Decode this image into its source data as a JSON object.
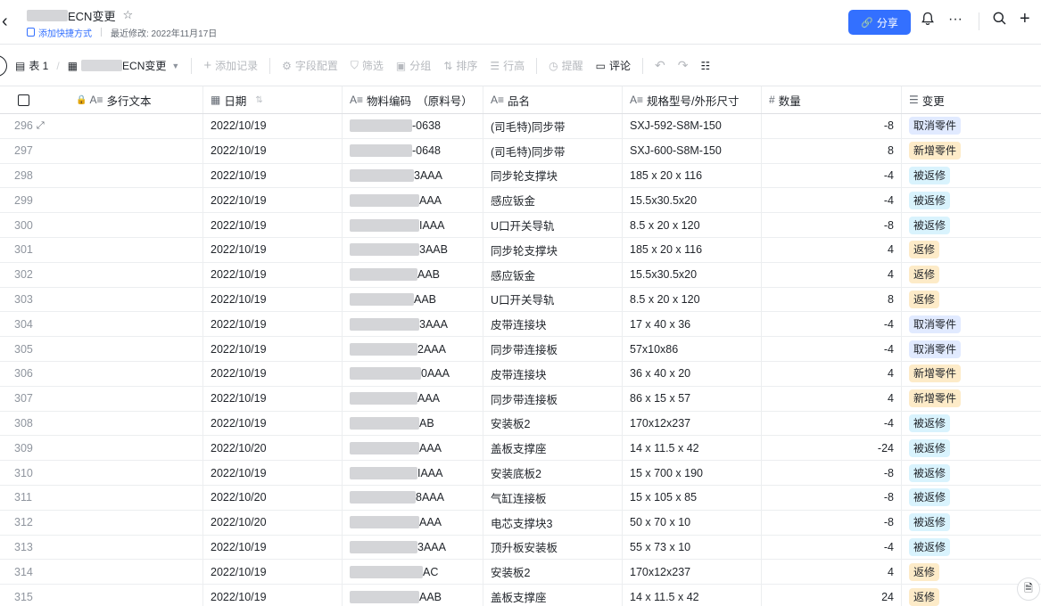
{
  "header": {
    "title_suffix": "ECN变更",
    "shortcut_label": "添加快捷方式",
    "modified_label": "最近修改: 2022年11月17日",
    "share_label": "分享"
  },
  "toolbar": {
    "table_tab": "表 1",
    "view_name_suffix": "ECN变更",
    "add_record": "添加记录",
    "field_config": "字段配置",
    "filter": "筛选",
    "group": "分组",
    "sort": "排序",
    "row_height": "行高",
    "reminder": "提醒",
    "comment": "评论"
  },
  "columns": [
    {
      "label": "多行文本",
      "icon": "text-icon"
    },
    {
      "label": "日期",
      "icon": "calendar-icon"
    },
    {
      "label": "物料编码　（原料号）",
      "icon": "text-icon"
    },
    {
      "label": "品名",
      "icon": "text-icon"
    },
    {
      "label": "规格型号/外形尺寸",
      "icon": "text-icon"
    },
    {
      "label": "数量",
      "icon": "number-icon"
    },
    {
      "label": "变更",
      "icon": "list-icon"
    }
  ],
  "rows": [
    {
      "n": "296",
      "date": "2022/10/19",
      "code": "-0638",
      "name": "(司毛特)同步带",
      "spec": "SXJ-592-S8M-150",
      "qty": "-8",
      "change": "取消零件",
      "tag": "cancel"
    },
    {
      "n": "297",
      "date": "2022/10/19",
      "code": "-0648",
      "name": "(司毛特)同步带",
      "spec": "SXJ-600-S8M-150",
      "qty": "8",
      "change": "新增零件",
      "tag": "add"
    },
    {
      "n": "298",
      "date": "2022/10/19",
      "code": "3AAA",
      "name": "同步轮支撑块",
      "spec": "185 x 20 x 116",
      "qty": "-4",
      "change": "被返修",
      "tag": "returned"
    },
    {
      "n": "299",
      "date": "2022/10/19",
      "code": "AAA",
      "name": "感应钣金",
      "spec": "15.5x30.5x20",
      "qty": "-4",
      "change": "被返修",
      "tag": "returned"
    },
    {
      "n": "300",
      "date": "2022/10/19",
      "code": "IAAA",
      "name": "U口开关导轨",
      "spec": "8.5 x 20 x 120",
      "qty": "-8",
      "change": "被返修",
      "tag": "returned"
    },
    {
      "n": "301",
      "date": "2022/10/19",
      "code": "3AAB",
      "name": "同步轮支撑块",
      "spec": "185 x 20 x 116",
      "qty": "4",
      "change": "返修",
      "tag": "return"
    },
    {
      "n": "302",
      "date": "2022/10/19",
      "code": "AAB",
      "name": "感应钣金",
      "spec": "15.5x30.5x20",
      "qty": "4",
      "change": "返修",
      "tag": "return"
    },
    {
      "n": "303",
      "date": "2022/10/19",
      "code": "AAB",
      "name": "U口开关导轨",
      "spec": "8.5 x 20 x 120",
      "qty": "8",
      "change": "返修",
      "tag": "return"
    },
    {
      "n": "304",
      "date": "2022/10/19",
      "code": "3AAA",
      "name": "皮带连接块",
      "spec": "17 x 40 x 36",
      "qty": "-4",
      "change": "取消零件",
      "tag": "cancel"
    },
    {
      "n": "305",
      "date": "2022/10/19",
      "code": "2AAA",
      "name": "同步带连接板",
      "spec": "57x10x86",
      "qty": "-4",
      "change": "取消零件",
      "tag": "cancel"
    },
    {
      "n": "306",
      "date": "2022/10/19",
      "code": "0AAA",
      "name": "皮带连接块",
      "spec": "36 x 40 x 20",
      "qty": "4",
      "change": "新增零件",
      "tag": "add"
    },
    {
      "n": "307",
      "date": "2022/10/19",
      "code": "AAA",
      "name": "同步带连接板",
      "spec": "86 x 15 x 57",
      "qty": "4",
      "change": "新增零件",
      "tag": "add"
    },
    {
      "n": "308",
      "date": "2022/10/19",
      "code": "AB",
      "name": "安装板2",
      "spec": "170x12x237",
      "qty": "-4",
      "change": "被返修",
      "tag": "returned"
    },
    {
      "n": "309",
      "date": "2022/10/20",
      "code": "AAA",
      "name": "盖板支撑座",
      "spec": "14 x 11.5 x 42",
      "qty": "-24",
      "change": "被返修",
      "tag": "returned"
    },
    {
      "n": "310",
      "date": "2022/10/19",
      "code": "IAAA",
      "name": "安装底板2",
      "spec": "15 x 700 x 190",
      "qty": "-8",
      "change": "被返修",
      "tag": "returned"
    },
    {
      "n": "311",
      "date": "2022/10/20",
      "code": "8AAA",
      "name": "气缸连接板",
      "spec": "15 x 105 x 85",
      "qty": "-8",
      "change": "被返修",
      "tag": "returned"
    },
    {
      "n": "312",
      "date": "2022/10/20",
      "code": "AAA",
      "name": "电芯支撑块3",
      "spec": "50 x 70 x 10",
      "qty": "-8",
      "change": "被返修",
      "tag": "returned"
    },
    {
      "n": "313",
      "date": "2022/10/19",
      "code": "3AAA",
      "name": "顶升板安装板",
      "spec": "55 x 73 x 10",
      "qty": "-4",
      "change": "被返修",
      "tag": "returned"
    },
    {
      "n": "314",
      "date": "2022/10/19",
      "code": "AC",
      "name": "安装板2",
      "spec": "170x12x237",
      "qty": "4",
      "change": "返修",
      "tag": "return"
    },
    {
      "n": "315",
      "date": "2022/10/19",
      "code": "AAB",
      "name": "盖板支撑座",
      "spec": "14 x 11.5 x 42",
      "qty": "24",
      "change": "返修",
      "tag": "return"
    }
  ]
}
